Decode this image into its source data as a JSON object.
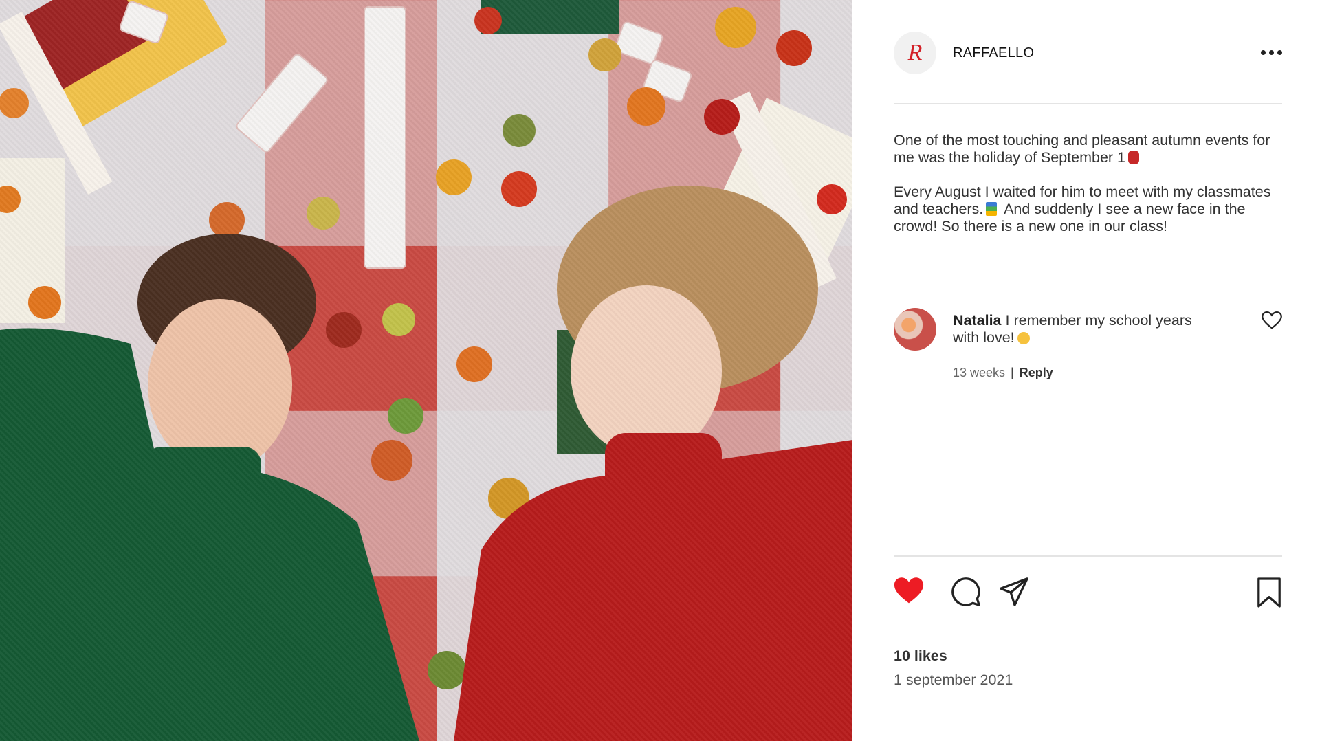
{
  "photo": {
    "icon": "post-photo",
    "description_label": ""
  },
  "account": {
    "name": "RAFFAELLO",
    "avatar_letter": "R",
    "brand_color": "#d32027"
  },
  "caption": {
    "paragraph_1": "One of the most touching and pleasant autumn events for me was the holiday of September 1",
    "paragraph_2_a": "Every August I waited for him to meet with my classmates and teachers.",
    "paragraph_2_b": "And suddenly I see a new face in the crowd! So there is a new one in our class!"
  },
  "comment": {
    "author": "Natalia",
    "text": "I remember my school years with love!",
    "time": "13 weeks",
    "separator": "|",
    "reply_label": "Reply"
  },
  "actions": {
    "liked": true,
    "like_color": "#ed1c24"
  },
  "likes": "10 likes",
  "date": "1 september 2021"
}
